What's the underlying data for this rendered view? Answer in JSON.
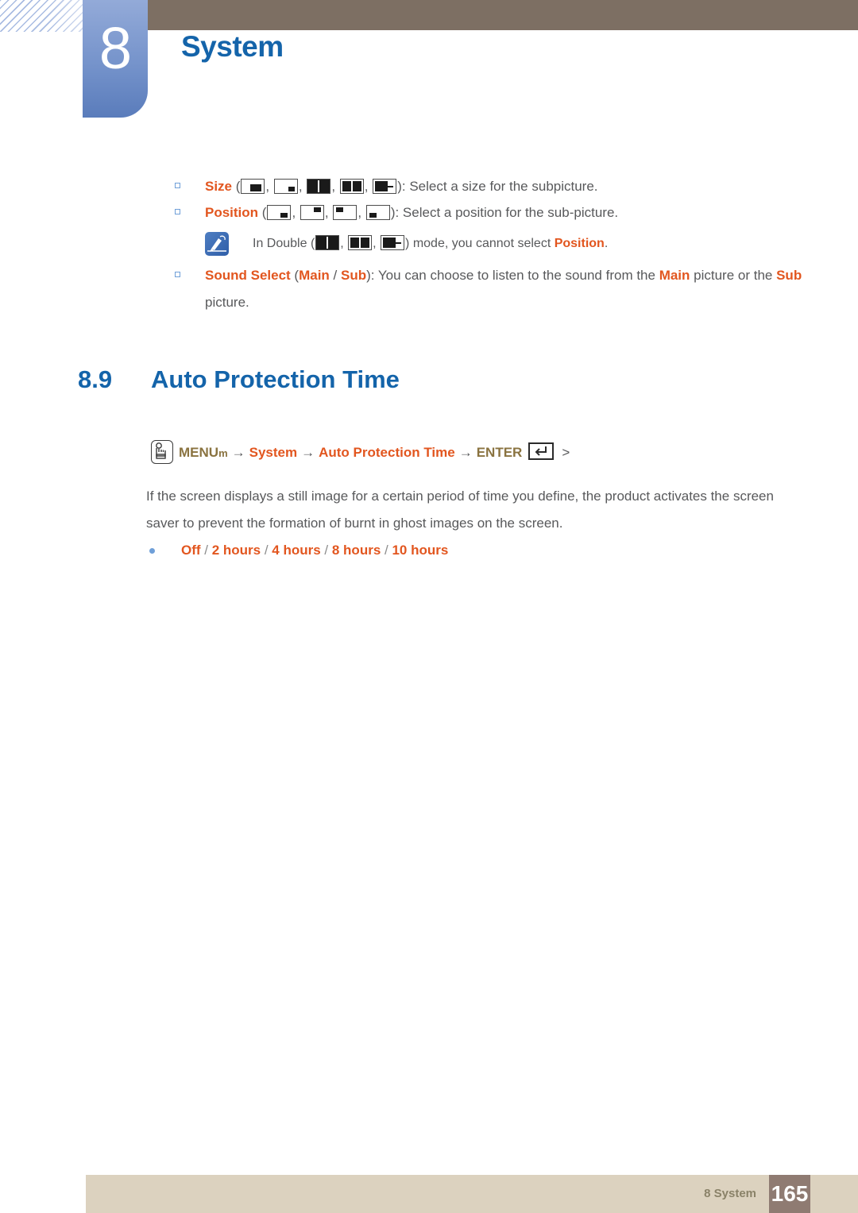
{
  "header": {
    "chapter_number": "8",
    "chapter_title": "System"
  },
  "bullets": {
    "size": {
      "keyword": "Size",
      "open_paren": " (",
      "close_paren": "): ",
      "description": "Select a size for the subpicture.",
      "icons": [
        "pip-size-large",
        "pip-size-small",
        "pip-double-vertical",
        "pip-double-side-by-side",
        "pip-double-wide"
      ]
    },
    "position": {
      "keyword": "Position",
      "open_paren": " (",
      "close_paren": "): ",
      "description": "Select a position for the sub-picture.",
      "icons": [
        "pip-pos-bottom-right",
        "pip-pos-top-right",
        "pip-pos-top-left",
        "pip-pos-bottom-left"
      ]
    },
    "sound_select": {
      "keyword": "Sound Select",
      "open_paren": " (",
      "option_main": "Main",
      "option_sep": " / ",
      "option_sub": "Sub",
      "close_paren": "): ",
      "text_1": "You can choose to listen to the sound from the ",
      "emph_main": "Main",
      "text_2": " picture or the ",
      "emph_sub": "Sub",
      "text_3": " picture."
    }
  },
  "note": {
    "icon": "note-pen-icon",
    "text_1": "In Double (",
    "icons": [
      "pip-double-vertical",
      "pip-double-side-by-side",
      "pip-double-wide"
    ],
    "text_2": ") mode, you cannot select ",
    "emph": "Position",
    "text_3": "."
  },
  "section": {
    "number": "8.9",
    "title": "Auto Protection Time"
  },
  "menu_path": {
    "hand_icon": "hand-press-icon",
    "menu_label": "MENU",
    "menu_small": "m",
    "arrow": "→",
    "item_system": "System",
    "item_auto_protection_time": "Auto Protection Time",
    "enter_label": "ENTER",
    "enter_icon": "enter-key-icon",
    "trailing": ">"
  },
  "body": {
    "paragraph": "If the screen displays a still image for a certain period of time you define, the product activates the screen saver to prevent the formation of burnt in ghost images on the screen."
  },
  "options": {
    "items": [
      "Off",
      "2 hours",
      "4 hours",
      "8 hours",
      "10 hours"
    ],
    "separator": " / "
  },
  "footer": {
    "label": "8 System",
    "page_number": "165"
  },
  "colors": {
    "brand_blue": "#1464aa",
    "accent_orange": "#e2561f",
    "tab_blue": "#7593cb",
    "header_brown": "#7d6f63",
    "footer_beige": "#dcd2bf",
    "page_box_brown": "#8f7b72",
    "menu_gold": "#8a7340"
  }
}
